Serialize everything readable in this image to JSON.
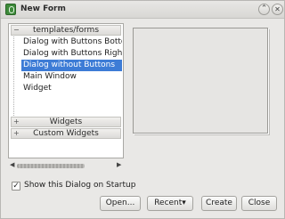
{
  "window": {
    "title": "New Form",
    "titlebar_up_glyph": "⌃",
    "titlebar_close_glyph": "✕"
  },
  "tree": {
    "groups": [
      {
        "label": "templates/forms",
        "expander": "−"
      },
      {
        "label": "Widgets",
        "expander": "+"
      },
      {
        "label": "Custom Widgets",
        "expander": "+"
      }
    ],
    "items": [
      {
        "label": "Dialog with Buttons Bottom"
      },
      {
        "label": "Dialog with Buttons Right"
      },
      {
        "label": "Dialog without Buttons"
      },
      {
        "label": "Main Window"
      },
      {
        "label": "Widget"
      }
    ],
    "selected_item": "Dialog without Buttons"
  },
  "scrollbar": {
    "left_glyph": "◀",
    "right_glyph": "▶"
  },
  "startup": {
    "label": "Show this Dialog on Startup",
    "checked": true,
    "check_glyph": "✓"
  },
  "buttons": {
    "open": "Open...",
    "recent": "Recent▾",
    "create": "Create",
    "close": "Close"
  },
  "icons": {
    "app": "qt-designer-app-icon",
    "titlebar_up": "chevron-up-icon",
    "titlebar_close": "close-icon"
  }
}
